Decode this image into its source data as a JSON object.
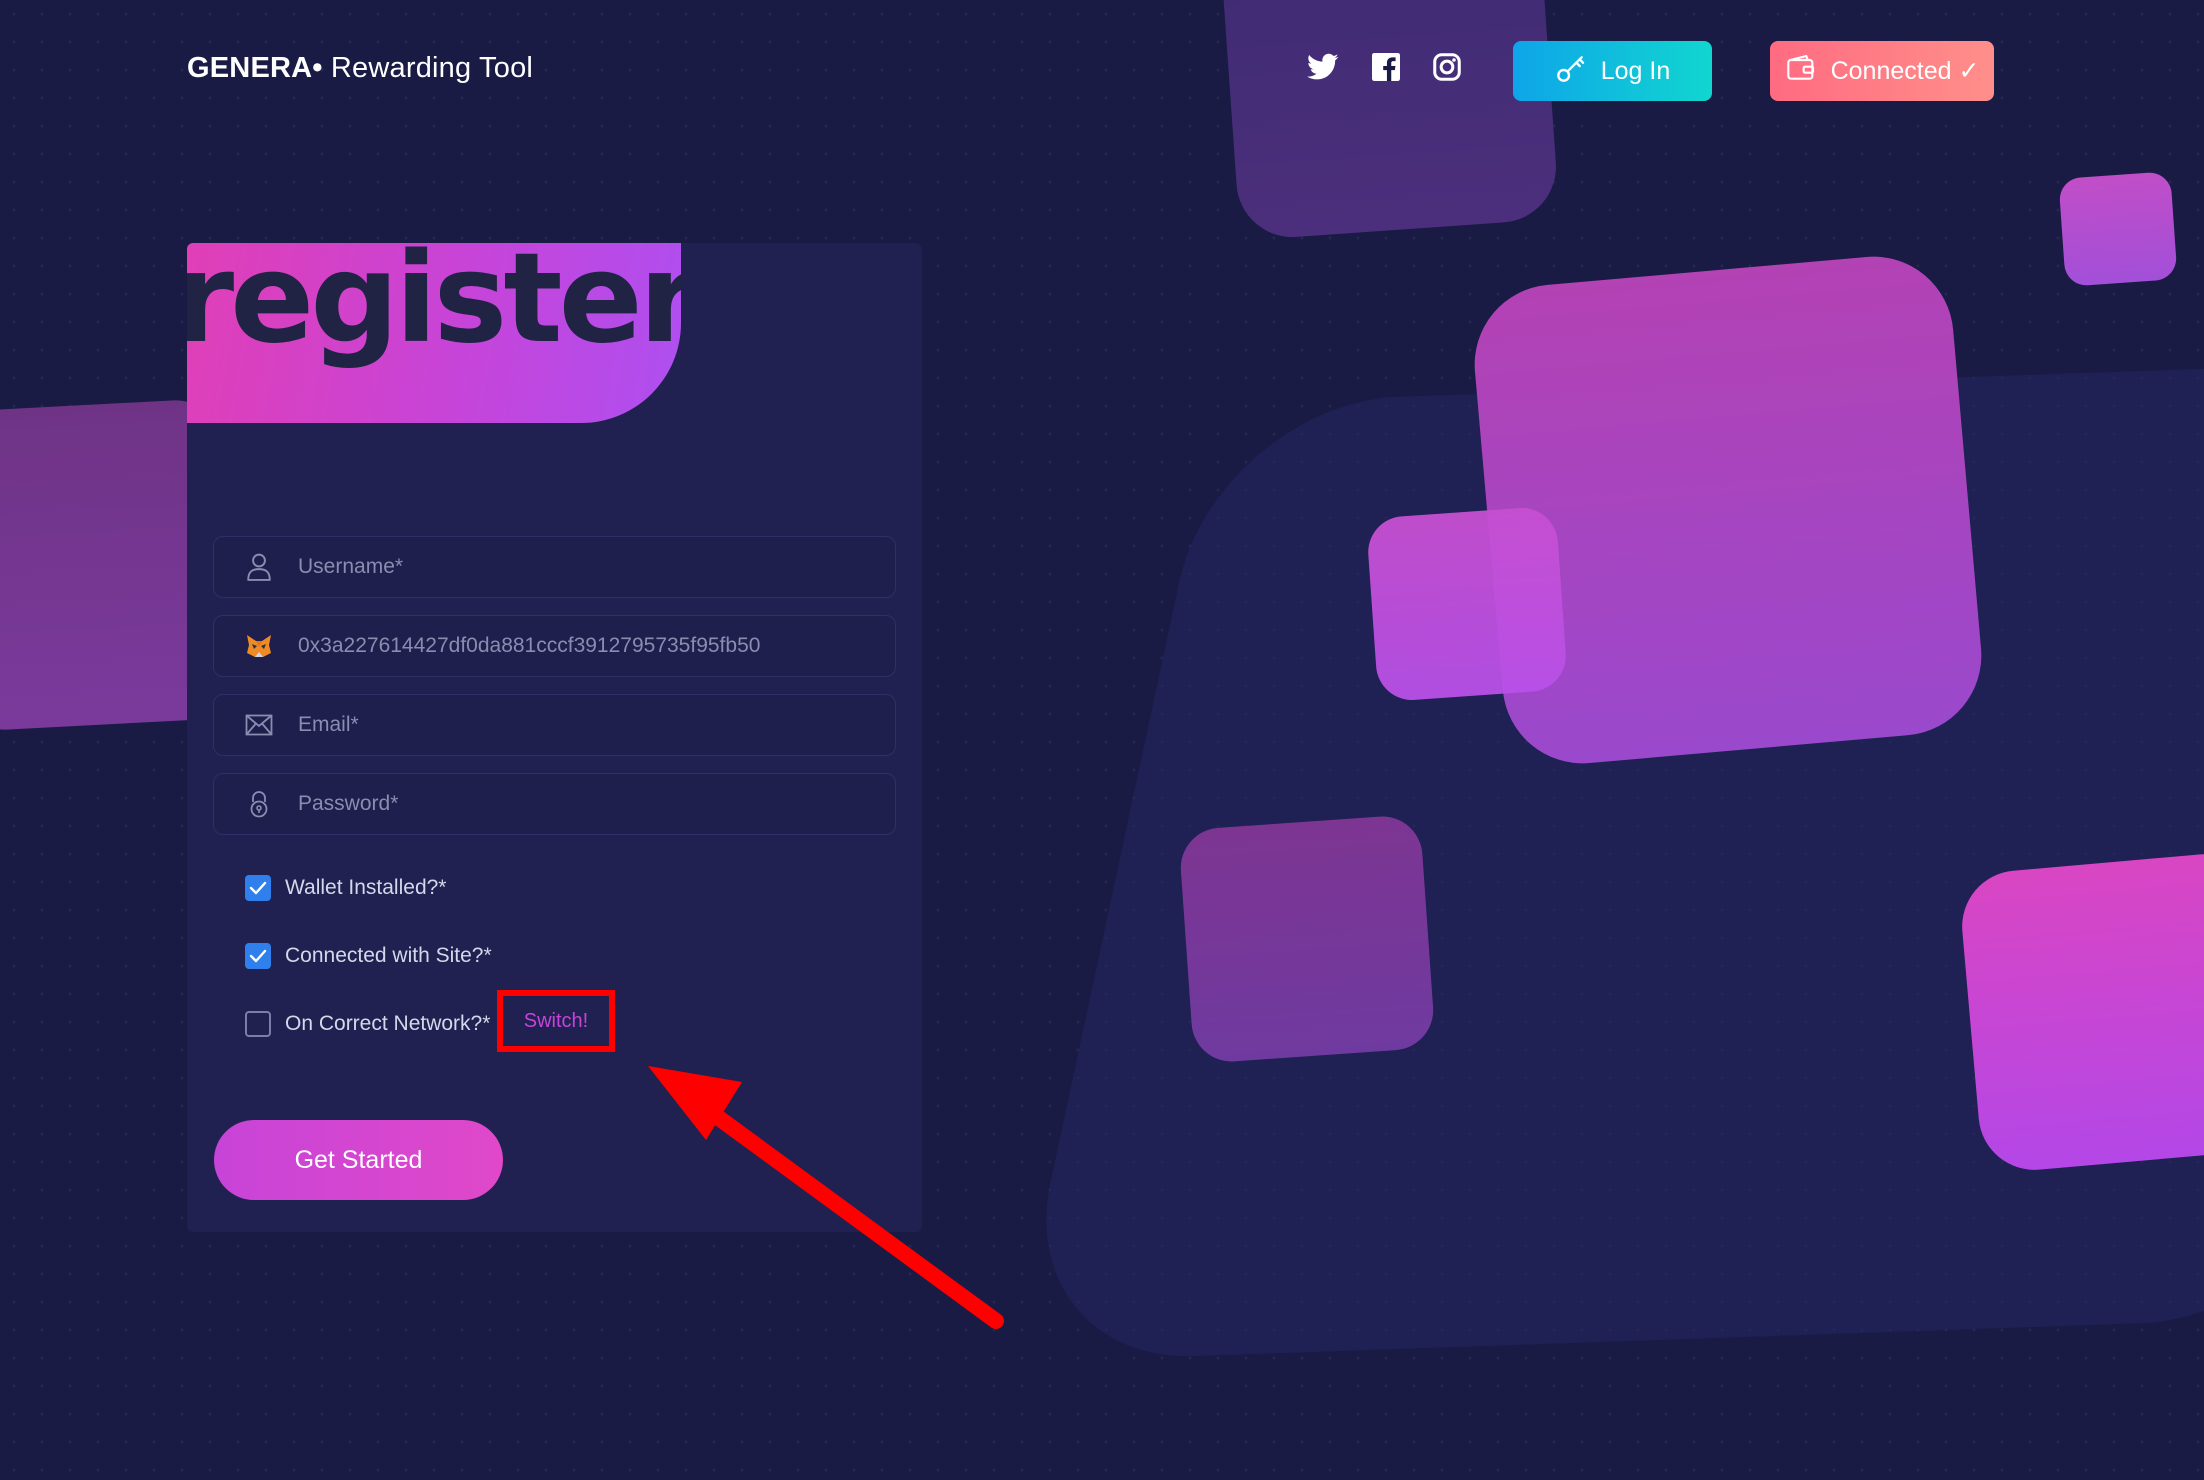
{
  "header": {
    "brand_bold": "GENERA•",
    "brand_rest": "Rewarding Tool",
    "social": [
      "twitter-icon",
      "facebook-icon",
      "instagram-icon"
    ],
    "login_label": "Log In",
    "connected_label": "Connected ✓"
  },
  "card": {
    "title": "register",
    "fields": {
      "username_placeholder": "Username*",
      "wallet_address": "0x3a227614427df0da881cccf3912795735f95fb50",
      "email_placeholder": "Email*",
      "password_placeholder": "Password*"
    },
    "checks": [
      {
        "label": "Wallet Installed?*",
        "checked": true
      },
      {
        "label": "Connected with Site?*",
        "checked": true
      },
      {
        "label": "On Correct Network?*",
        "checked": false
      }
    ],
    "switch_label": "Switch!",
    "submit_label": "Get Started"
  },
  "colors": {
    "background": "#191b45",
    "card": "#202150",
    "accent_pink": "#e03fb6",
    "accent_purple": "#ae4ff1",
    "login_gradient": [
      "#0ea5e9",
      "#11d6cf"
    ],
    "connected_gradient": [
      "#ff6b81",
      "#ff8f8a"
    ],
    "checkbox_on": "#2f80ed",
    "annotation_red": "#ff0000"
  }
}
